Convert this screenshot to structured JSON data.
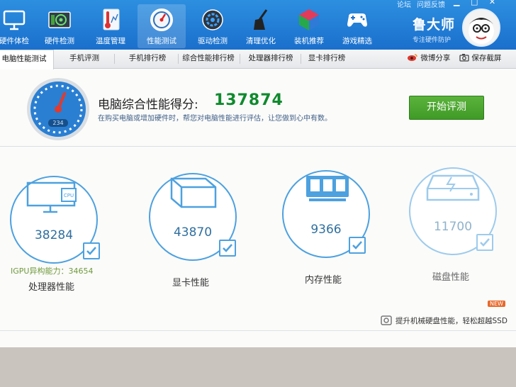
{
  "window": {
    "title_fragments": [
      "论坛",
      "问题反馈"
    ]
  },
  "toolbar": {
    "items": [
      {
        "label": "硬件体检",
        "icon": "monitor-check-icon"
      },
      {
        "label": "硬件检测",
        "icon": "graphics-card-icon"
      },
      {
        "label": "温度管理",
        "icon": "thermometer-icon"
      },
      {
        "label": "性能测试",
        "icon": "speedometer-icon"
      },
      {
        "label": "驱动检测",
        "icon": "gear-icon"
      },
      {
        "label": "清理优化",
        "icon": "broom-icon"
      },
      {
        "label": "装机推荐",
        "icon": "cube-icon"
      },
      {
        "label": "游戏精选",
        "icon": "gamepad-icon"
      }
    ],
    "active_index": 3
  },
  "brand": {
    "name": "鲁大师",
    "slogan": "专注硬件防护"
  },
  "tabs": [
    {
      "label": "电脑性能测试"
    },
    {
      "label": "手机评测"
    },
    {
      "label": "手机排行榜"
    },
    {
      "label": "综合性能排行榜"
    },
    {
      "label": "处理器排行榜"
    },
    {
      "label": "显卡排行榜"
    }
  ],
  "tab_actions": {
    "share": "微博分享",
    "save": "保存截屏"
  },
  "score": {
    "title": "电脑综合性能得分:",
    "value": "137874",
    "subtitle": "在购买电脑或增加硬件时，帮您对电脑性能进行评估，让您做到心中有数。",
    "gauge_text": "234",
    "start_button": "开始评测"
  },
  "metrics": [
    {
      "name": "处理器性能",
      "value": "38284",
      "icon": "cpu-monitor-icon"
    },
    {
      "name": "显卡性能",
      "value": "43870",
      "icon": "graphics-cube-icon"
    },
    {
      "name": "内存性能",
      "value": "9366",
      "icon": "memory-chip-icon"
    },
    {
      "name": "磁盘性能",
      "value": "11700",
      "icon": "hard-disk-icon"
    }
  ],
  "igpu": {
    "label": "IGPU异构能力：",
    "value": "34654"
  },
  "footer": {
    "ssd_text": "提升机械硬盘性能，轻松超越SSD",
    "badge": "NEW"
  }
}
